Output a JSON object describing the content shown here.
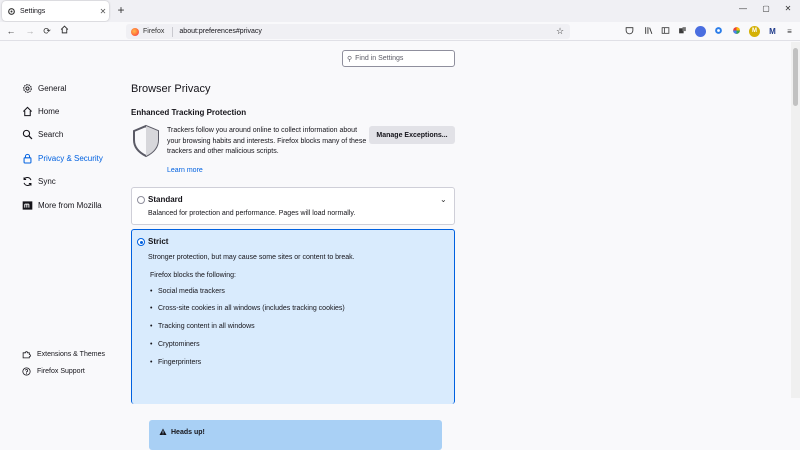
{
  "tab": {
    "title": "Settings",
    "close": "✕"
  },
  "window": {
    "minimize": "—",
    "maximize": "▢",
    "close": "✕"
  },
  "nav": {
    "new_tab": "+",
    "identity": "Firefox",
    "url": "about:preferences#privacy",
    "toolbar_badges": [
      {
        "name": "extension-badge-1",
        "label": "",
        "color": "#4a6ee0"
      },
      {
        "name": "extension-badge-2",
        "label": "",
        "color": "#3b3b3b"
      },
      {
        "name": "extension-badge-3",
        "label": "M",
        "color": "#d4b106"
      },
      {
        "name": "extension-badge-4",
        "label": "M",
        "color": "#1f3a8a"
      }
    ]
  },
  "search": {
    "placeholder": "Find in Settings"
  },
  "sidebar": {
    "items": [
      {
        "label": "General",
        "icon": "gear-icon"
      },
      {
        "label": "Home",
        "icon": "home-icon"
      },
      {
        "label": "Search",
        "icon": "search-icon"
      },
      {
        "label": "Privacy & Security",
        "icon": "lock-icon",
        "active": true
      },
      {
        "label": "Sync",
        "icon": "sync-icon"
      },
      {
        "label": "More from Mozilla",
        "icon": "mozilla-icon"
      }
    ],
    "footer": [
      {
        "label": "Extensions & Themes",
        "icon": "puzzle-icon"
      },
      {
        "label": "Firefox Support",
        "icon": "help-icon"
      }
    ]
  },
  "main": {
    "heading": "Browser Privacy",
    "etp_heading": "Enhanced Tracking Protection",
    "etp_desc": "Trackers follow you around online to collect information about your browsing habits and interests. Firefox blocks many of these trackers and other malicious scripts.",
    "learn_more": "Learn more",
    "manage_button": "Manage Exceptions...",
    "standard": {
      "label": "Standard",
      "desc": "Balanced for protection and performance. Pages will load normally."
    },
    "strict": {
      "label": "Strict",
      "desc": "Stronger protection, but may cause some sites or content to break.",
      "blocks_heading": "Firefox blocks the following:",
      "blocks": [
        "Social media trackers",
        "Cross-site cookies in all windows (includes tracking cookies)",
        "Tracking content in all windows",
        "Cryptominers",
        "Fingerprinters"
      ],
      "heads_up": "Heads up!"
    }
  },
  "colors": {
    "accent": "#0061e0",
    "strict_bg": "#d9ebfd",
    "headsup_bg": "#a9d0f5"
  }
}
